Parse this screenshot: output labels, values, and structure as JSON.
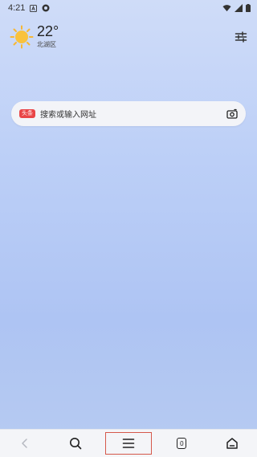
{
  "status_bar": {
    "time": "4:21"
  },
  "weather": {
    "temperature": "22°",
    "location": "北湖区",
    "icon": "sun-icon"
  },
  "search": {
    "brand_badge": "头条",
    "placeholder": "搜索或输入网址"
  },
  "bottom_nav": {
    "tabs_count": "0",
    "items": [
      {
        "name": "back",
        "icon": "chevron-left-icon"
      },
      {
        "name": "search",
        "icon": "search-icon"
      },
      {
        "name": "menu",
        "icon": "menu-icon"
      },
      {
        "name": "tabs",
        "icon": "tabs-icon"
      },
      {
        "name": "home",
        "icon": "home-icon"
      }
    ]
  },
  "colors": {
    "brand_red": "#e94547",
    "highlight_border": "#d5584b",
    "background_top": "#cfdcf8",
    "background_bottom": "#b7cbf1"
  }
}
